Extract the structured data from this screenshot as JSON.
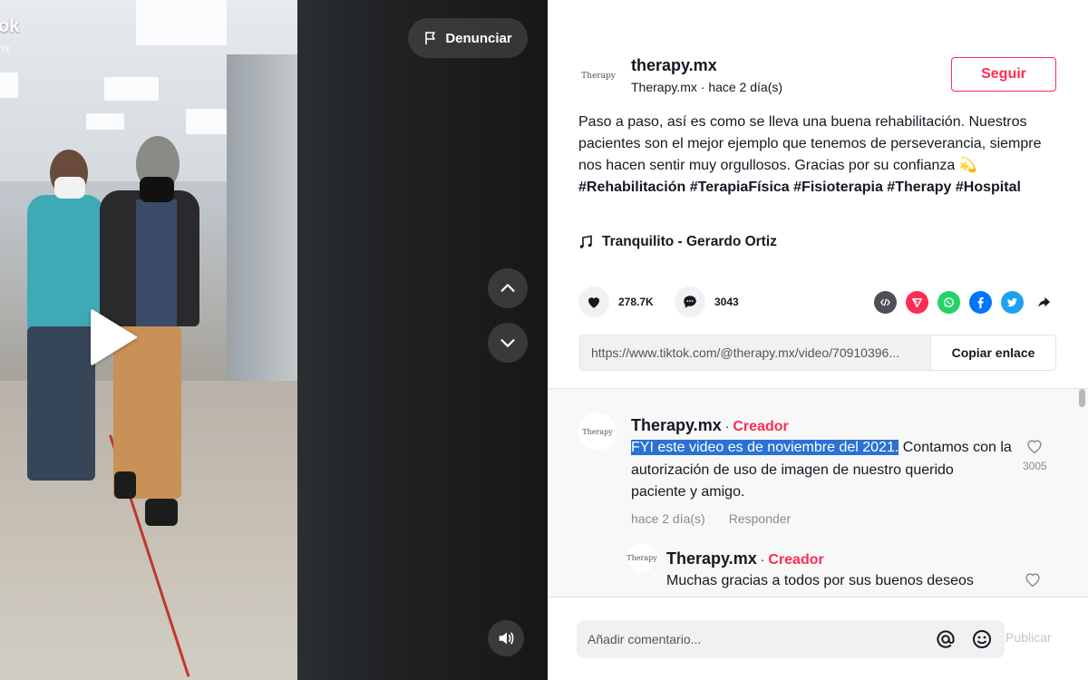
{
  "video": {
    "brand_partial": "ok",
    "brand_sub_partial": "nx",
    "report_label": "Denunciar",
    "icons": {
      "report": "flag-icon",
      "play": "play-icon",
      "prev": "chevron-up-icon",
      "next": "chevron-down-icon",
      "volume": "volume-icon"
    }
  },
  "author": {
    "avatar_text": "Therapy",
    "username": "therapy.mx",
    "meta": "Therapy.mx · hace 2 día(s)",
    "follow_label": "Seguir"
  },
  "caption": {
    "text": "Paso a paso, así es como se lleva una buena rehabilitación. Nuestros pacientes son el mejor ejemplo que tenemos de perseverancia, siempre nos hacen sentir muy orgullosos. Gracias por su confianza ",
    "emoji": "💫",
    "tags": [
      "#Rehabilitación",
      "#TerapiaFísica",
      "#Fisioterapia",
      "#Therapy",
      "#Hospital"
    ]
  },
  "music": {
    "icon": "music-note-icon",
    "title": "Tranquilito - Gerardo Ortiz"
  },
  "stats": {
    "likes": "278.7K",
    "comments": "3043"
  },
  "share": {
    "icons": [
      "embed-icon",
      "send-icon",
      "whatsapp-icon",
      "facebook-icon",
      "twitter-icon",
      "share-arrow-icon"
    ],
    "colors": {
      "embed": "#4f4f57",
      "send": "#fe2c55",
      "whatsapp": "#25d366",
      "facebook": "#0075fa",
      "twitter": "#1da1f2"
    }
  },
  "link": {
    "url": "https://www.tiktok.com/@therapy.mx/video/70910396...",
    "copy_label": "Copiar enlace"
  },
  "comments": [
    {
      "avatar_text": "Therapy",
      "name": "Therapy.mx",
      "separator": "·",
      "badge": "Creador",
      "text_highlight": "FYI este video es de noviembre del 2021.",
      "text_rest": " Contamos con la autorización de uso de imagen de nuestro querido paciente y amigo.",
      "time": "hace 2 día(s)",
      "reply_label": "Responder",
      "likes": "3005"
    },
    {
      "avatar_text": "Therapy",
      "name": "Therapy.mx",
      "separator": "·",
      "badge": "Creador",
      "text": "Muchas gracias a todos por sus buenos deseos"
    }
  ],
  "composer": {
    "placeholder": "Añadir comentario...",
    "mention_icon": "at-icon",
    "emoji_icon": "emoji-icon",
    "post_label": "Publicar"
  },
  "colors": {
    "accent": "#fe2c55",
    "highlight": "#2a72d4"
  }
}
